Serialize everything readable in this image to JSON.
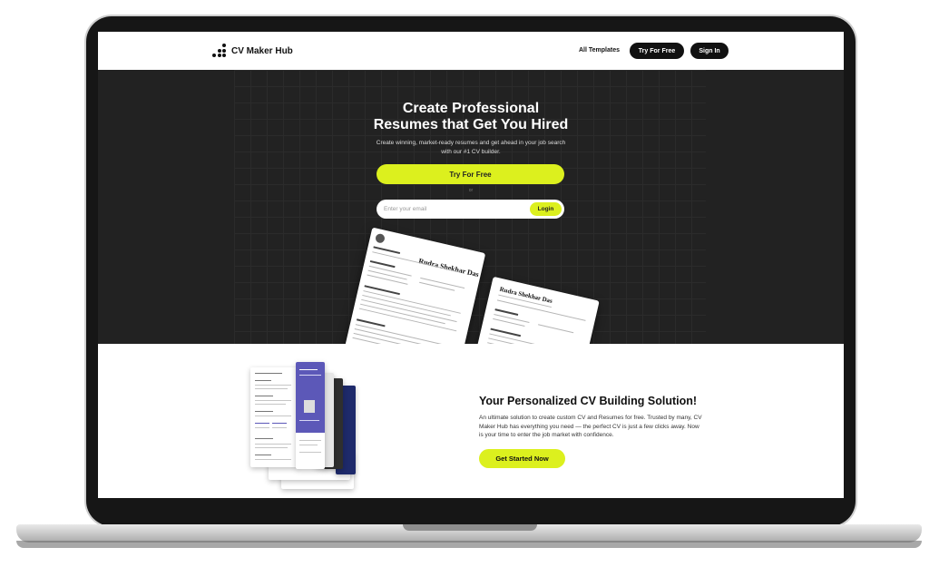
{
  "nav": {
    "logo_text": "CV Maker Hub",
    "all_templates": "All Templates",
    "try_free": "Try For Free",
    "sign_in": "Sign In"
  },
  "hero": {
    "title_line1": "Create Professional",
    "title_line2": "Resumes that Get You Hired",
    "subtitle": "Create winning, market-ready resumes and get ahead in your job search with our #1 CV builder.",
    "cta": "Try For Free",
    "or_text": "or",
    "email_placeholder": "Enter your email",
    "login": "Login",
    "resume_name": "Rudra Shekhar Das"
  },
  "features": {
    "title": "Your Personalized CV Building Solution!",
    "text": "An ultimate solution to create custom CV and Resumes for free. Trusted by many, CV Maker Hub has everything you need — the perfect CV is just a few clicks away. Now is your time to enter the job market with confidence.",
    "cta": "Get Started Now"
  },
  "colors": {
    "accent": "#dcf01e",
    "hero_bg": "#222222",
    "dark_button": "#111111",
    "template_purple": "#5c58b8",
    "template_navy": "#1e2a6b"
  }
}
